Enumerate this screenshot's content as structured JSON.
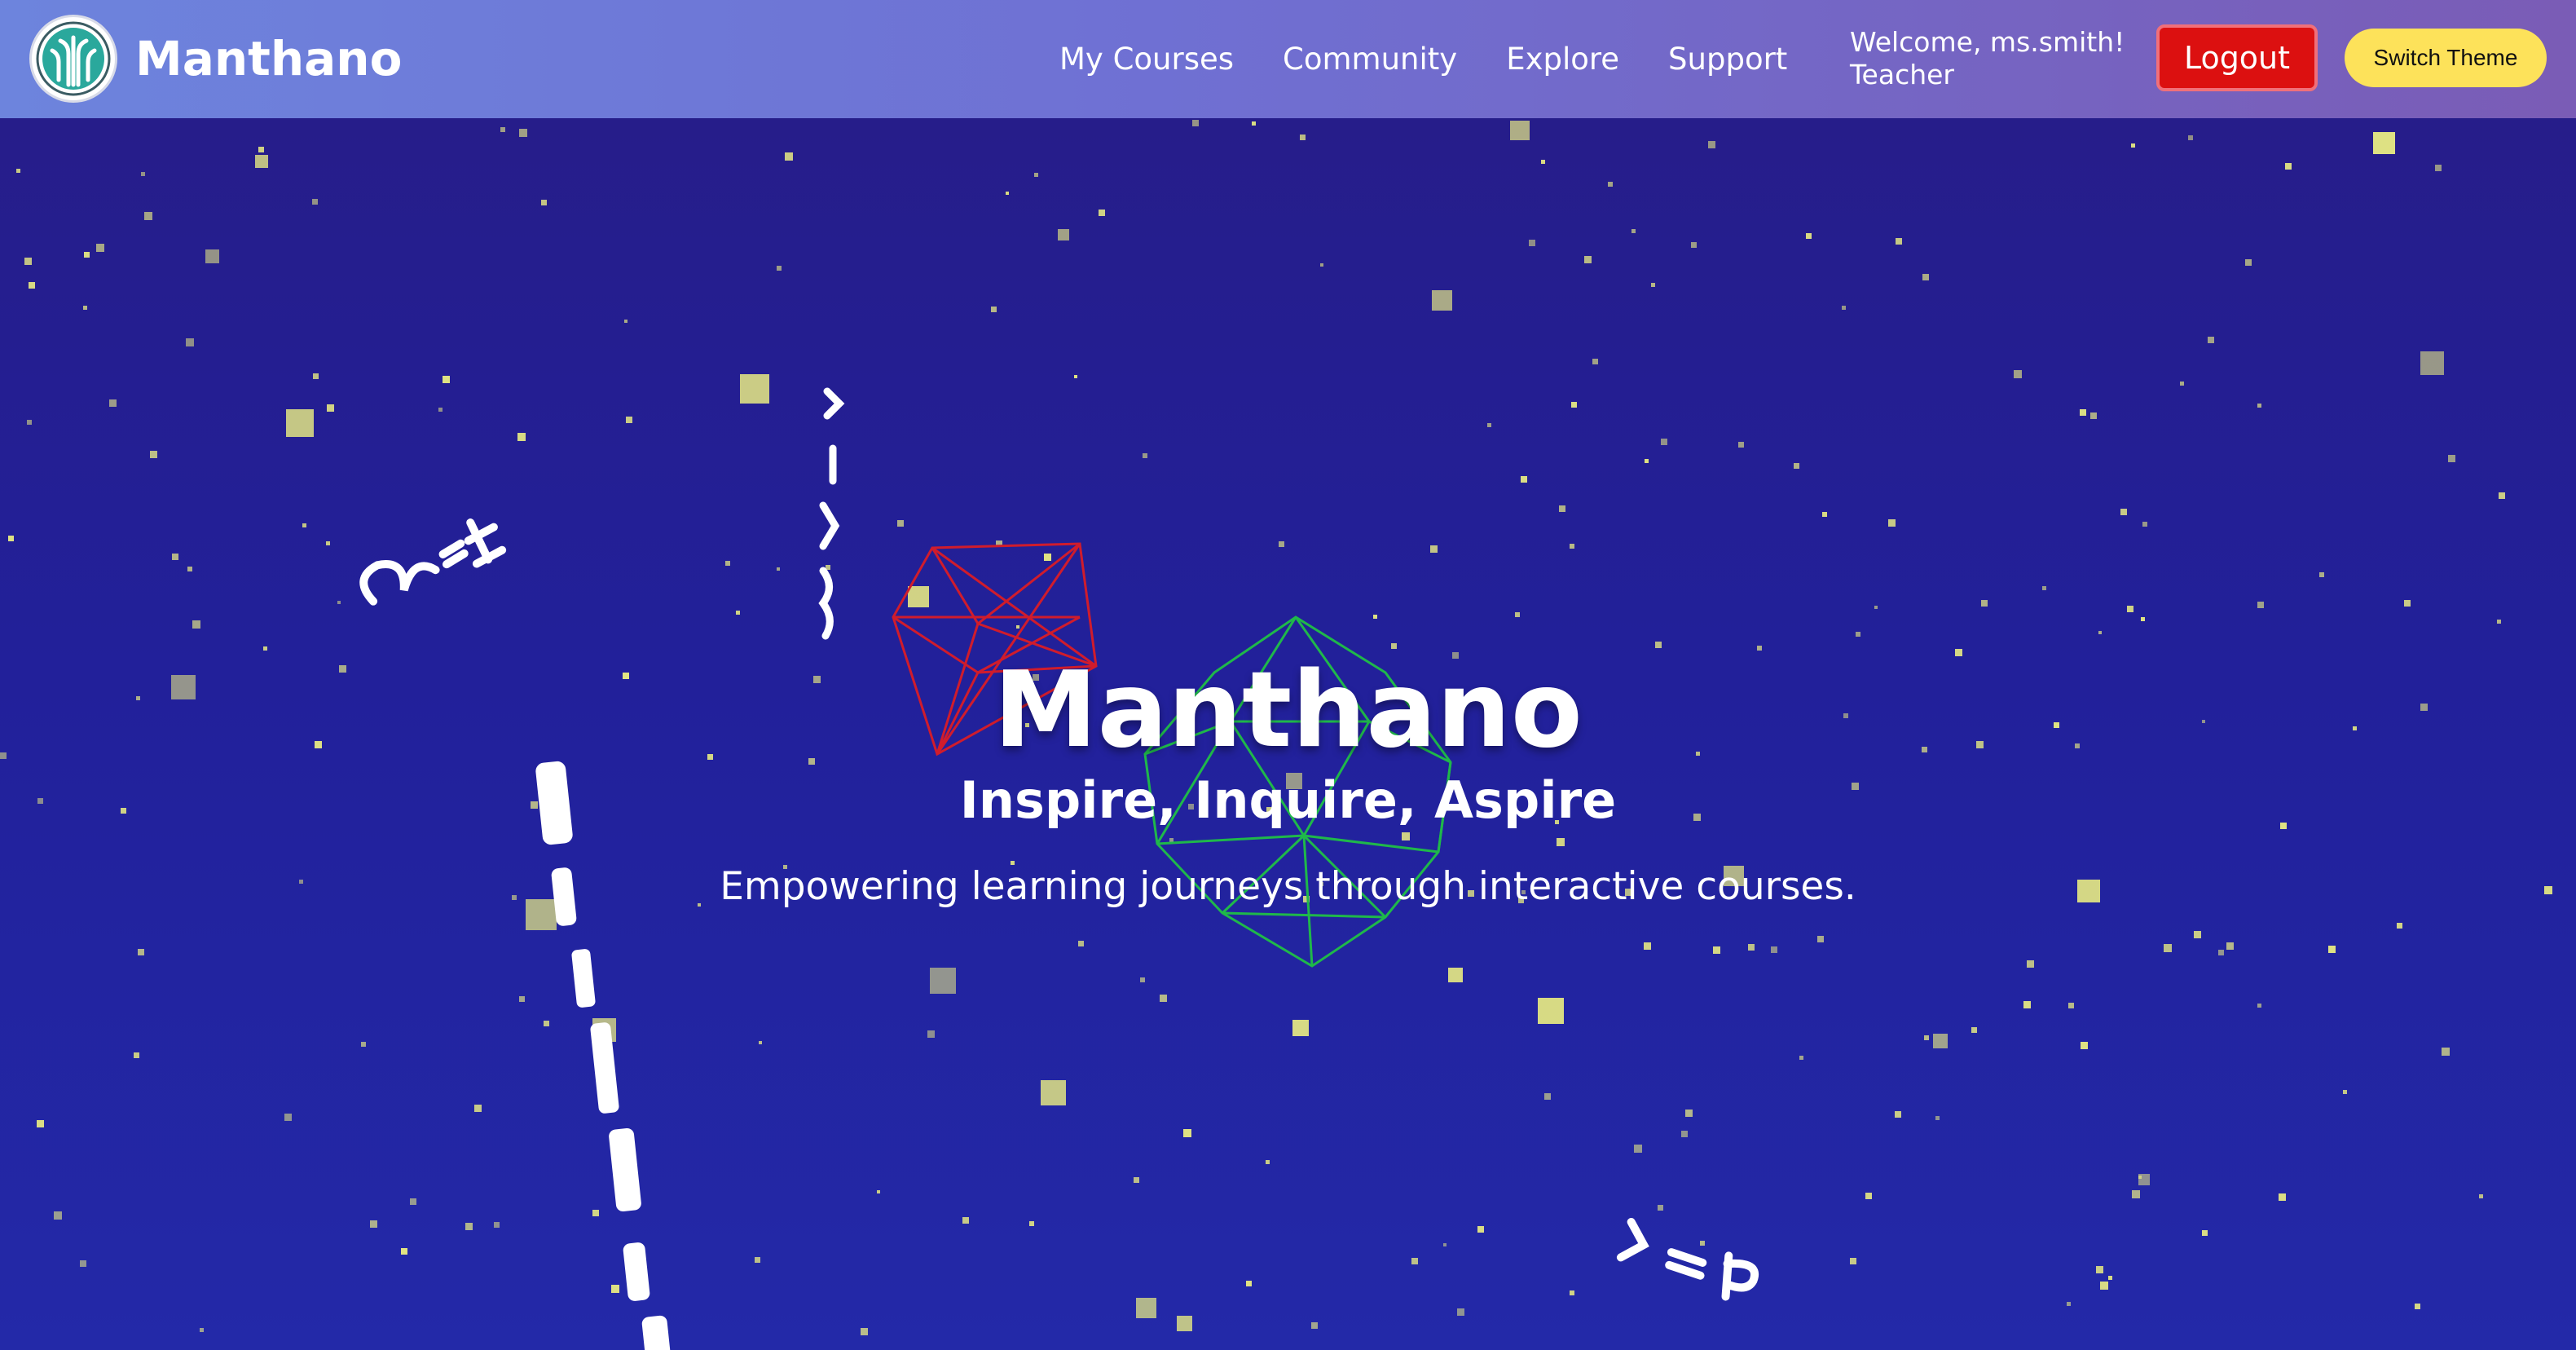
{
  "brand": {
    "name": "Manthano",
    "logo_icon": "tree-logo-icon"
  },
  "nav": {
    "links": [
      {
        "label": "My Courses"
      },
      {
        "label": "Community"
      },
      {
        "label": "Explore"
      },
      {
        "label": "Support"
      }
    ]
  },
  "user": {
    "welcome": "Welcome, ms.smith!",
    "role": "Teacher"
  },
  "actions": {
    "logout_label": "Logout",
    "switch_theme_label": "Switch Theme"
  },
  "hero": {
    "title": "Manthano",
    "subtitle": "Inspire, Inquire, Aspire",
    "description": "Empowering learning journeys through interactive courses."
  },
  "colors": {
    "navbar_start": "#6d84dd",
    "navbar_end": "#7a5cb6",
    "hero_background": "#23229a",
    "logout": "#dc1010",
    "switch_theme": "#fde25a",
    "particle": "#e2e583",
    "cube_wireframe": "#d01c2c",
    "polyhedron_wireframe": "#1fb84a"
  }
}
